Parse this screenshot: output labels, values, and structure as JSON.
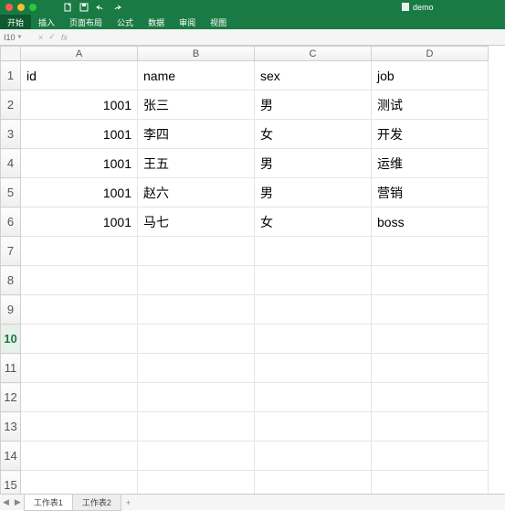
{
  "app": {
    "filename": "demo"
  },
  "menu": {
    "items": [
      "开始",
      "插入",
      "页面布局",
      "公式",
      "数据",
      "审阅",
      "视图"
    ]
  },
  "formulabar": {
    "namebox": "I10",
    "cancel": "×",
    "confirm": "✓",
    "fx": "fx",
    "value": ""
  },
  "sheet": {
    "columns": [
      "A",
      "B",
      "C",
      "D"
    ],
    "visible_row_count": 15,
    "active_row": 10,
    "headers_row": 1,
    "data_start_row": 2,
    "headers": {
      "A": "id",
      "B": "name",
      "C": "sex",
      "D": "job"
    },
    "rows": [
      {
        "A": "1001",
        "B": "张三",
        "C": "男",
        "D": "测试"
      },
      {
        "A": "1001",
        "B": "李四",
        "C": "女",
        "D": "开发"
      },
      {
        "A": "1001",
        "B": "王五",
        "C": "男",
        "D": "运维"
      },
      {
        "A": "1001",
        "B": "赵六",
        "C": "男",
        "D": "营销"
      },
      {
        "A": "1001",
        "B": "马七",
        "C": "女",
        "D": "boss"
      }
    ]
  },
  "tabs": {
    "sheets": [
      "工作表1",
      "工作表2"
    ],
    "active": 0,
    "add": "+"
  },
  "chart_data": {
    "type": "table",
    "title": "",
    "columns": [
      "id",
      "name",
      "sex",
      "job"
    ],
    "rows": [
      [
        "1001",
        "张三",
        "男",
        "测试"
      ],
      [
        "1001",
        "李四",
        "女",
        "开发"
      ],
      [
        "1001",
        "王五",
        "男",
        "运维"
      ],
      [
        "1001",
        "赵六",
        "男",
        "营销"
      ],
      [
        "1001",
        "马七",
        "女",
        "boss"
      ]
    ]
  }
}
